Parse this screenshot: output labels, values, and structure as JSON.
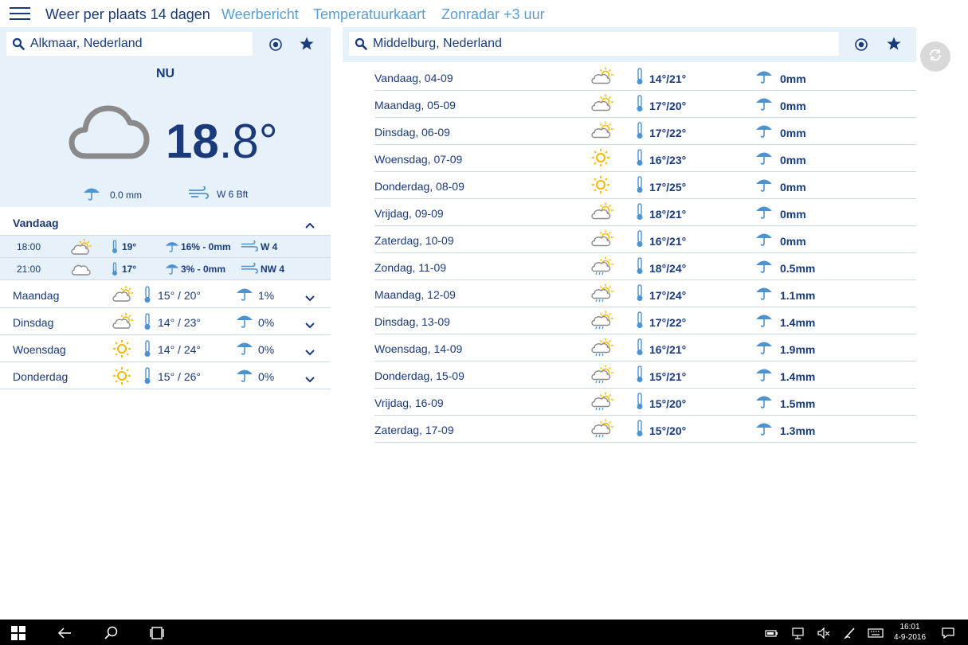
{
  "nav": {
    "items": [
      {
        "label": "Weer per plaats 14 dagen",
        "active": true
      },
      {
        "label": "Weerbericht",
        "active": false
      },
      {
        "label": "Temperatuurkaart",
        "active": false
      },
      {
        "label": "Zonradar +3 uur",
        "active": false
      }
    ]
  },
  "left": {
    "search_value": "Alkmaar, Nederland",
    "now_label": "NU",
    "now_icon": "cloud-icon",
    "temp_int": "18",
    "temp_dec": ".8°",
    "precip": "0.0 mm",
    "wind": "W 6 Bft",
    "today_label": "Vandaag",
    "hourly": [
      {
        "time": "18:00",
        "icon": "partly-sunny-icon",
        "temp": "19°",
        "precip": "16% - 0mm",
        "wind": "W 4"
      },
      {
        "time": "21:00",
        "icon": "cloud-icon",
        "temp": "17°",
        "precip": "3% - 0mm",
        "wind": "NW 4"
      }
    ],
    "days": [
      {
        "name": "Maandag",
        "icon": "partly-sunny-icon",
        "temp": "15° / 20°",
        "precip": "1%"
      },
      {
        "name": "Dinsdag",
        "icon": "partly-sunny-icon",
        "temp": "14° / 23°",
        "precip": "0%"
      },
      {
        "name": "Woensdag",
        "icon": "sun-icon",
        "temp": "14° / 24°",
        "precip": "0%"
      },
      {
        "name": "Donderdag",
        "icon": "sun-icon",
        "temp": "15° / 26°",
        "precip": "0%"
      }
    ]
  },
  "right": {
    "search_value": "Middelburg, Nederland",
    "forecast": [
      {
        "day": "Vandaag, 04-09",
        "icon": "partly-sunny-icon",
        "temp": "14°/21°",
        "precip": "0mm"
      },
      {
        "day": "Maandag, 05-09",
        "icon": "partly-sunny-icon",
        "temp": "17°/20°",
        "precip": "0mm"
      },
      {
        "day": "Dinsdag, 06-09",
        "icon": "partly-sunny-icon",
        "temp": "17°/22°",
        "precip": "0mm"
      },
      {
        "day": "Woensdag, 07-09",
        "icon": "sun-icon",
        "temp": "16°/23°",
        "precip": "0mm"
      },
      {
        "day": "Donderdag, 08-09",
        "icon": "sun-icon",
        "temp": "17°/25°",
        "precip": "0mm"
      },
      {
        "day": "Vrijdag, 09-09",
        "icon": "partly-sunny-icon",
        "temp": "18°/21°",
        "precip": "0mm"
      },
      {
        "day": "Zaterdag, 10-09",
        "icon": "partly-sunny-icon",
        "temp": "16°/21°",
        "precip": "0mm"
      },
      {
        "day": "Zondag, 11-09",
        "icon": "sun-shower-icon",
        "temp": "18°/24°",
        "precip": "0.5mm"
      },
      {
        "day": "Maandag, 12-09",
        "icon": "sun-shower-icon",
        "temp": "17°/24°",
        "precip": "1.1mm"
      },
      {
        "day": "Dinsdag, 13-09",
        "icon": "sun-shower-icon",
        "temp": "17°/22°",
        "precip": "1.4mm"
      },
      {
        "day": "Woensdag, 14-09",
        "icon": "sun-shower-icon",
        "temp": "16°/21°",
        "precip": "1.9mm"
      },
      {
        "day": "Donderdag, 15-09",
        "icon": "sun-shower-icon",
        "temp": "15°/21°",
        "precip": "1.4mm"
      },
      {
        "day": "Vrijdag, 16-09",
        "icon": "sun-shower-icon",
        "temp": "15°/20°",
        "precip": "1.5mm"
      },
      {
        "day": "Zaterdag, 17-09",
        "icon": "sun-shower-icon",
        "temp": "15°/20°",
        "precip": "1.3mm"
      }
    ]
  },
  "taskbar": {
    "time": "16:01",
    "date": "4-9-2016"
  },
  "colors": {
    "navy": "#1a3a7a",
    "link": "#5a9fd4",
    "panel": "#e7f1fa",
    "sun": "#f5b800",
    "icon_blue": "#4d93d1"
  }
}
